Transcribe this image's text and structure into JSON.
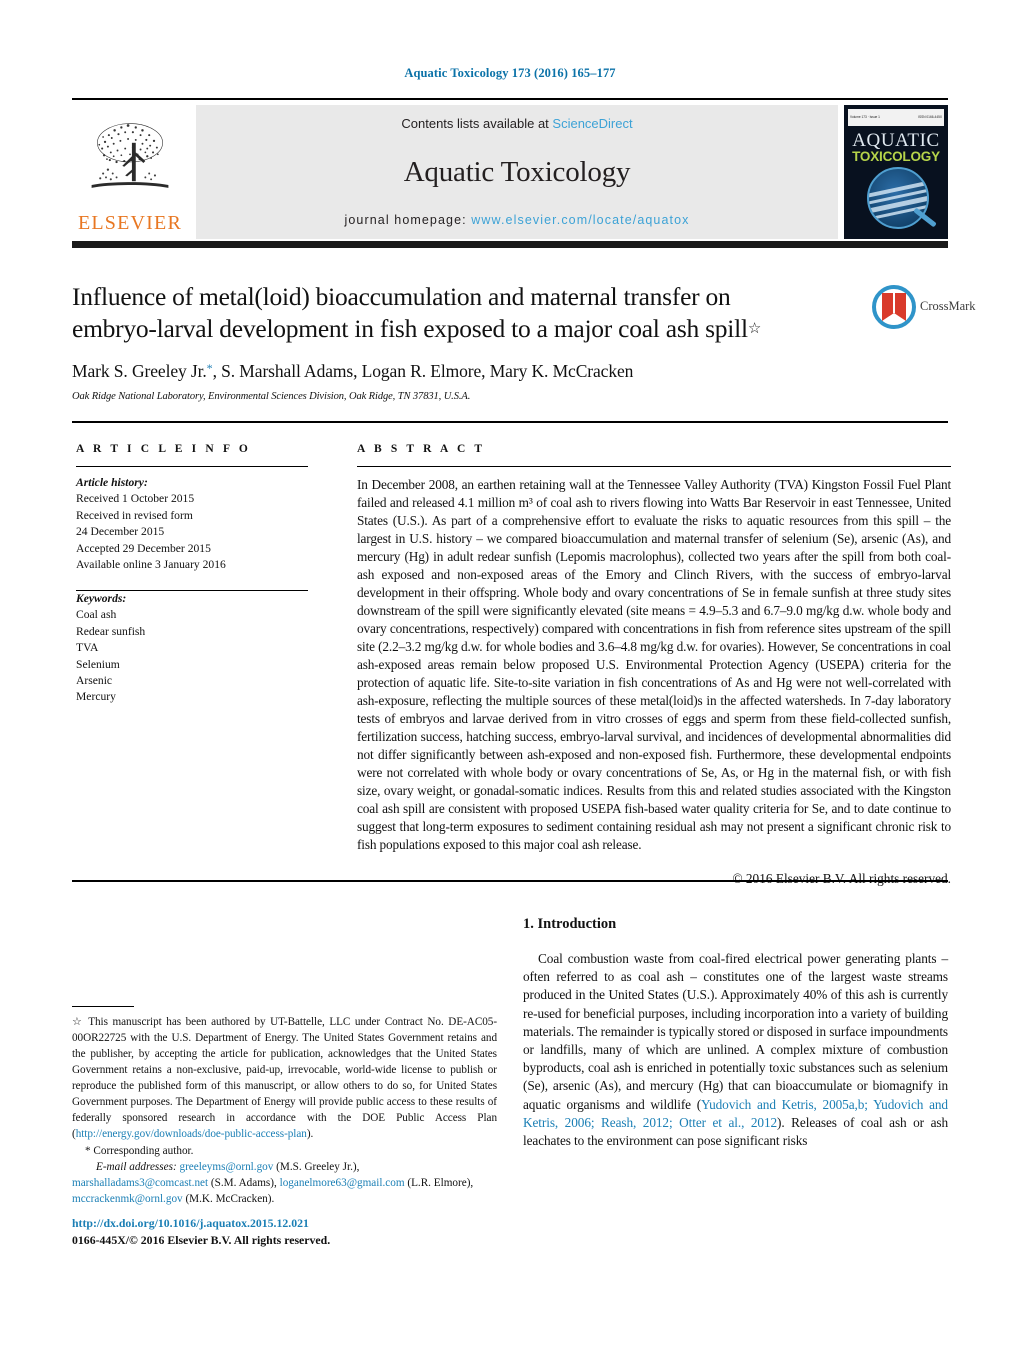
{
  "running_head": "Aquatic Toxicology 173 (2016) 165–177",
  "masthead": {
    "contents_prefix": "Contents lists available at ",
    "contents_link": "ScienceDirect",
    "journal_name": "Aquatic Toxicology",
    "homepage_label": "journal homepage:",
    "homepage_url": "www.elsevier.com/locate/aquatox",
    "publisher_logo_text": "ELSEVIER",
    "cover": {
      "line1": "AQUATIC",
      "line2": "TOXICOLOGY",
      "header_left": "Volume 173 · Issue 1",
      "header_right": "ISSN 0166-445X"
    }
  },
  "article": {
    "title_line1": "Influence of metal(loid) bioaccumulation and maternal transfer on",
    "title_line2": "embryo-larval development in fish exposed to a major coal ash spill",
    "title_marker": "☆",
    "authors": "Mark S. Greeley Jr.",
    "author_marker": "*",
    "authors_rest": ", S. Marshall Adams, Logan R. Elmore, Mary K. McCracken",
    "affiliation": "Oak Ridge National Laboratory, Environmental Sciences Division, Oak Ridge, TN 37831, U.S.A."
  },
  "crossmark": {
    "label": "CrossMark"
  },
  "info": {
    "heading": "A R T I C L E   I N F O",
    "history_label": "Article history:",
    "history": [
      "Received 1 October 2015",
      "Received in revised form",
      "24 December 2015",
      "Accepted 29 December 2015",
      "Available online 3 January 2016"
    ],
    "keywords_label": "Keywords:",
    "keywords": [
      "Coal ash",
      "Redear sunfish",
      "TVA",
      "Selenium",
      "Arsenic",
      "Mercury"
    ]
  },
  "abstract": {
    "heading": "A B S T R A C T",
    "text": "In December 2008, an earthen retaining wall at the Tennessee Valley Authority (TVA) Kingston Fossil Fuel Plant failed and released 4.1 million m³ of coal ash to rivers flowing into Watts Bar Reservoir in east Tennessee, United States (U.S.). As part of a comprehensive effort to evaluate the risks to aquatic resources from this spill – the largest in U.S. history – we compared bioaccumulation and maternal transfer of selenium (Se), arsenic (As), and mercury (Hg) in adult redear sunfish (Lepomis macrolophus), collected two years after the spill from both coal-ash exposed and non-exposed areas of the Emory and Clinch Rivers, with the success of embryo-larval development in their offspring. Whole body and ovary concentrations of Se in female sunfish at three study sites downstream of the spill were significantly elevated (site means = 4.9–5.3 and 6.7–9.0 mg/kg d.w. whole body and ovary concentrations, respectively) compared with concentrations in fish from reference sites upstream of the spill site (2.2–3.2 mg/kg d.w. for whole bodies and 3.6–4.8 mg/kg d.w. for ovaries). However, Se concentrations in coal ash-exposed areas remain below proposed U.S. Environmental Protection Agency (USEPA) criteria for the protection of aquatic life. Site-to-site variation in fish concentrations of As and Hg were not well-correlated with ash-exposure, reflecting the multiple sources of these metal(loid)s in the affected watersheds. In 7-day laboratory tests of embryos and larvae derived from in vitro crosses of eggs and sperm from these field-collected sunfish, fertilization success, hatching success, embryo-larval survival, and incidences of developmental abnormalities did not differ significantly between ash-exposed and non-exposed fish. Furthermore, these developmental endpoints were not correlated with whole body or ovary concentrations of Se, As, or Hg in the maternal fish, or with fish size, ovary weight, or gonadal-somatic indices. Results from this and related studies associated with the Kingston coal ash spill are consistent with proposed USEPA fish-based water quality criteria for Se, and to date continue to suggest that long-term exposures to sediment containing residual ash may not present a significant chronic risk to fish populations exposed to this major coal ash release.",
    "copyright": "© 2016 Elsevier B.V. All rights reserved."
  },
  "introduction": {
    "heading": "1.  Introduction",
    "para1_part1": "Coal combustion waste from coal-fired electrical power generating plants – often referred to as coal ash – constitutes one of the largest waste streams produced in the United States (U.S.). Approximately 40% of this ash is currently re-used for beneficial purposes, including incorporation into a variety of building materials. The remainder is typically stored or disposed in surface impoundments or landfills, many of which are unlined. A complex mixture of combustion byproducts, coal ash is enriched in potentially toxic substances such as selenium (Se), arsenic (As), and mercury (Hg) that can bioaccumulate or biomagnify in aquatic organisms and wildlife (",
    "citation": "Yudovich and Ketris, 2005a,b; Yudovich and Ketris, 2006; Reash, 2012; Otter et al., 2012",
    "para1_part2": "). Releases of coal ash or ash leachates to the environment can pose significant risks"
  },
  "footnote": {
    "marker": "☆",
    "text_part1": "  This manuscript has been authored by UT-Battelle, LLC under Contract No. DE-AC05-00OR22725 with the U.S. Department of Energy. The United States Government retains and the publisher, by accepting the article for publication, acknowledges that the United States Government retains a non-exclusive, paid-up, irrevocable, world-wide license to publish or reproduce the published form of this manuscript, or allow others to do so, for United States Government purposes. The Department of Energy will provide public access to these results of federally sponsored research in accordance with the DOE Public Access Plan (",
    "doe_link": "http://energy.gov/downloads/doe-public-access-plan",
    "text_part2": ").",
    "corresponding_marker": "*",
    "corresponding_label": " Corresponding author.",
    "email_label": "E-mail addresses:",
    "emails": [
      {
        "address": "greeleyms@ornl.gov",
        "owner": " (M.S. Greeley Jr.),"
      },
      {
        "address": "marshalladams3@comcast.net",
        "owner": " (S.M. Adams),"
      },
      {
        "address": "loganelmore63@gmail.com",
        "owner": " (L.R. Elmore),"
      },
      {
        "address": "mccrackenmk@ornl.gov",
        "owner": " (M.K. McCracken)."
      }
    ]
  },
  "doi": {
    "link": "http://dx.doi.org/10.1016/j.aquatox.2015.12.021",
    "issn_line": "0166-445X/© 2016 Elsevier B.V. All rights reserved."
  },
  "colors": {
    "link_blue": "#1b7fb5",
    "sciencedirect_blue": "#3ca2d6",
    "elsevier_orange": "#e87722",
    "cover_green": "#b6d44a"
  }
}
